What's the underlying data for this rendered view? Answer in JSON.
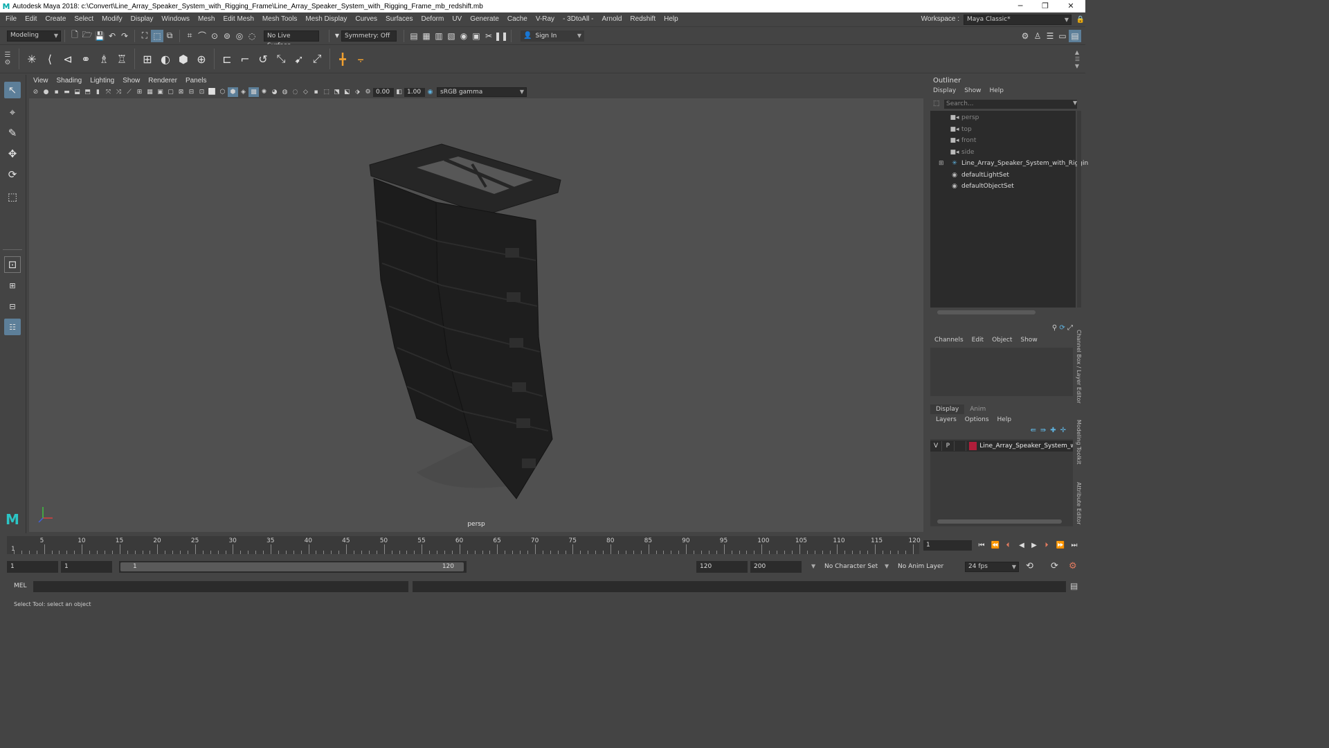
{
  "window": {
    "logo": "M",
    "title": "Autodesk Maya 2018: c:\\Convert\\Line_Array_Speaker_System_with_Rigging_Frame\\Line_Array_Speaker_System_with_Rigging_Frame_mb_redshift.mb",
    "minimize": "─",
    "maximize": "❐",
    "close": "✕"
  },
  "menu": [
    "File",
    "Edit",
    "Create",
    "Select",
    "Modify",
    "Display",
    "Windows",
    "Mesh",
    "Edit Mesh",
    "Mesh Tools",
    "Mesh Display",
    "Curves",
    "Surfaces",
    "Deform",
    "UV",
    "Generate",
    "Cache",
    "V-Ray",
    "- 3DtoAll -",
    "Arnold",
    "Redshift",
    "Help"
  ],
  "workspace": {
    "label": "Workspace :",
    "value": "Maya Classic*"
  },
  "statusline": {
    "mode": "Modeling",
    "live_surface": "No Live Surface",
    "symmetry": "Symmetry: Off",
    "signin": "Sign In"
  },
  "viewport": {
    "menu": [
      "View",
      "Shading",
      "Lighting",
      "Show",
      "Renderer",
      "Panels"
    ],
    "exposure": "0.00",
    "gamma": "1.00",
    "color_space": "sRGB gamma",
    "camera": "persp"
  },
  "outliner": {
    "title": "Outliner",
    "menu": [
      "Display",
      "Show",
      "Help"
    ],
    "search_placeholder": "Search...",
    "items": [
      {
        "label": "persp",
        "icon": "camera-icon",
        "dim": true
      },
      {
        "label": "top",
        "icon": "camera-icon",
        "dim": true
      },
      {
        "label": "front",
        "icon": "camera-icon",
        "dim": true
      },
      {
        "label": "side",
        "icon": "camera-icon",
        "dim": true
      },
      {
        "label": "Line_Array_Speaker_System_with_Riggin",
        "icon": "group-icon",
        "dim": false,
        "expand": "⊞"
      },
      {
        "label": "defaultLightSet",
        "icon": "set-icon",
        "dim": false
      },
      {
        "label": "defaultObjectSet",
        "icon": "set-icon",
        "dim": false
      }
    ]
  },
  "channelbox": {
    "menu": [
      "Channels",
      "Edit",
      "Object",
      "Show"
    ]
  },
  "layers": {
    "tabs": [
      "Display",
      "Anim"
    ],
    "menu": [
      "Layers",
      "Options",
      "Help"
    ],
    "row": {
      "v": "V",
      "p": "P",
      "name": "Line_Array_Speaker_System_wi",
      "color": "#b01e3a"
    }
  },
  "side_tabs": [
    "Channel Box / Layer Editor",
    "Modeling Toolkit",
    "Attribute Editor"
  ],
  "timeline": {
    "ticks": [
      "5",
      "10",
      "15",
      "20",
      "25",
      "30",
      "35",
      "40",
      "45",
      "50",
      "55",
      "60",
      "65",
      "70",
      "75",
      "80",
      "85",
      "90",
      "95",
      "100",
      "105",
      "110",
      "115",
      "120"
    ],
    "start_mark": "1",
    "current_frame": "1"
  },
  "range": {
    "start": "1",
    "start_inner": "1",
    "slider_start": "1",
    "slider_end": "120",
    "end_inner": "120",
    "end": "200",
    "character_set": "No Character Set",
    "anim_layer": "No Anim Layer",
    "fps": "24 fps"
  },
  "cmdline": {
    "label": "MEL"
  },
  "helpline": "Select Tool: select an object"
}
